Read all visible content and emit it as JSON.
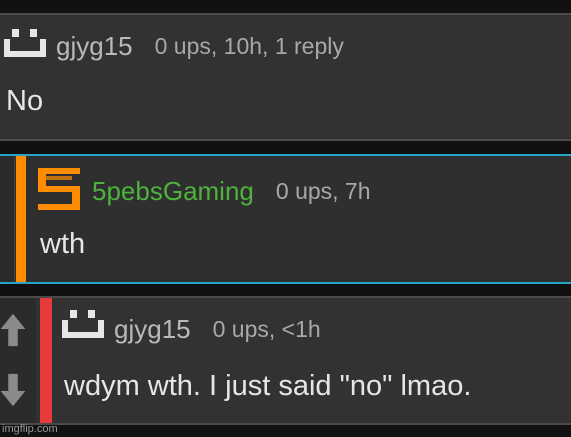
{
  "comments": [
    {
      "username": "gjyg15",
      "stats": "0 ups, 10h, 1 reply",
      "body": "No",
      "avatar_icon": "smiley-pixel-icon"
    },
    {
      "username": "5pebsGaming",
      "stats": "0 ups, 7h",
      "body": "wth",
      "avatar_icon": "5-logo-icon",
      "username_color": "#4db33d",
      "accent_color": "#ff8c00",
      "border_color": "#2aa3c9"
    },
    {
      "username": "gjyg15",
      "stats": "0 ups, <1h",
      "body": "wdym wth. I just said \"no\" lmao.",
      "avatar_icon": "smiley-pixel-icon",
      "accent_color": "#e83a3a"
    }
  ],
  "watermark": "imgflip.com"
}
